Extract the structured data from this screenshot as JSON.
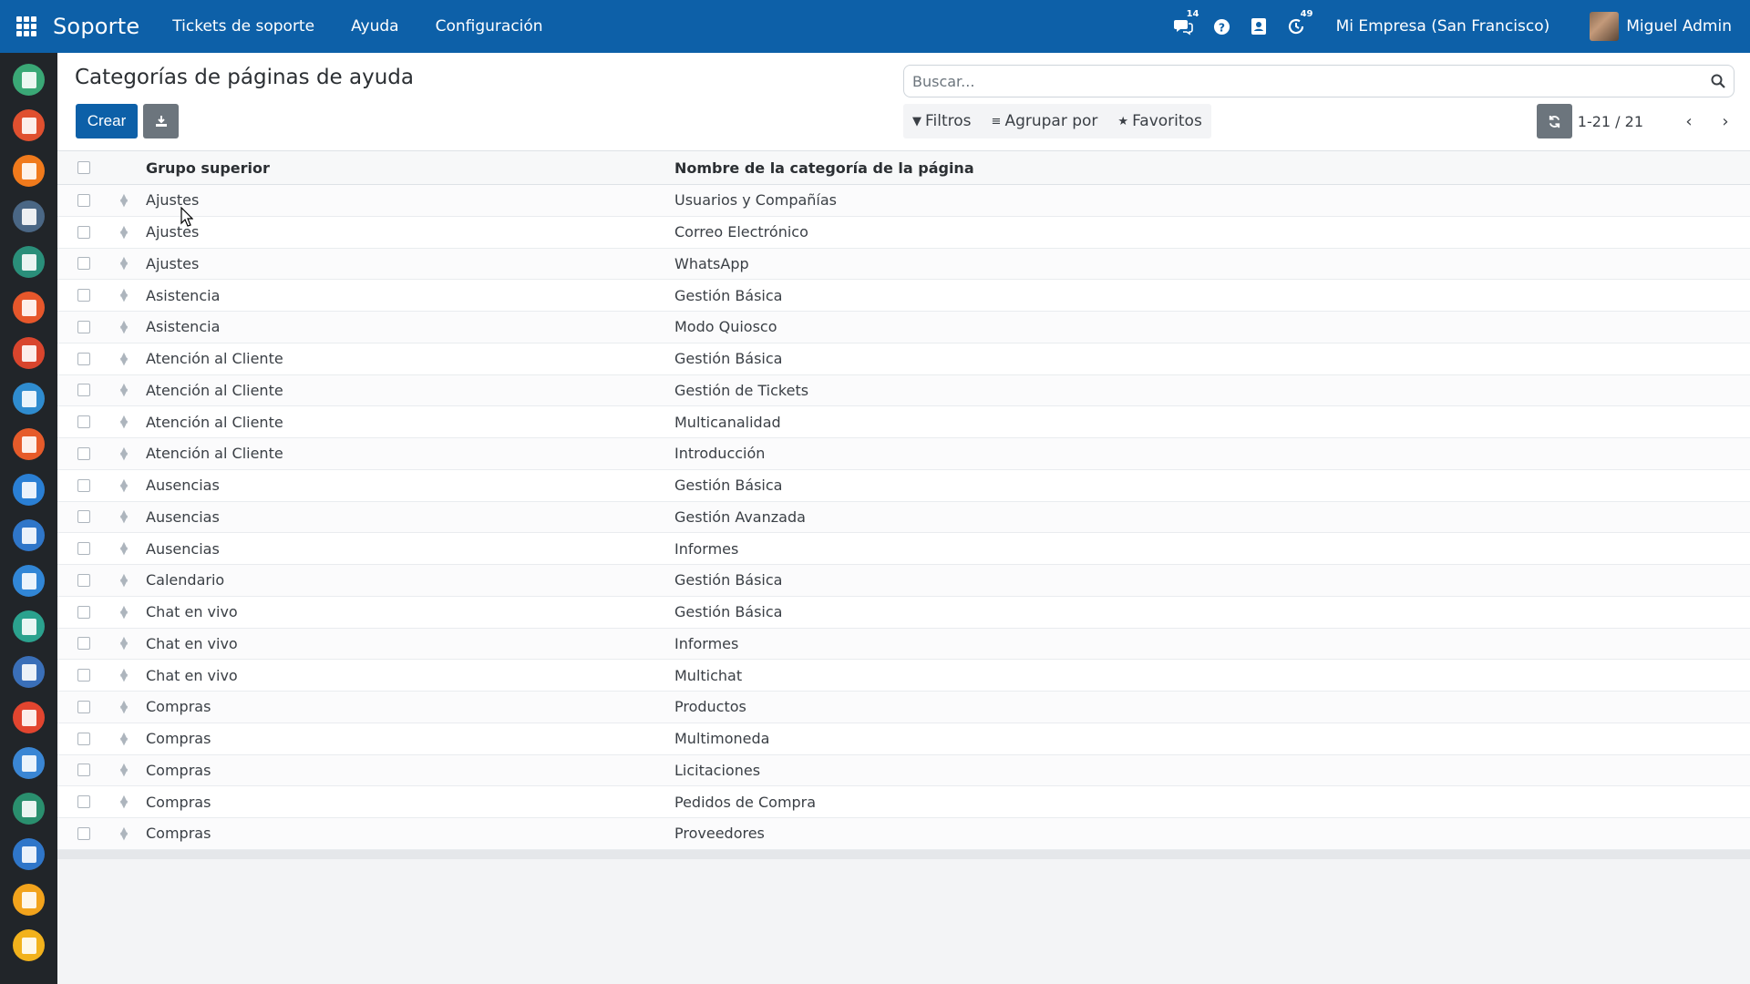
{
  "navbar": {
    "brand": "Soporte",
    "menu": [
      "Tickets de soporte",
      "Ayuda",
      "Configuración"
    ],
    "messages_count": "14",
    "activities_count": "49",
    "company": "Mi Empresa (San Francisco)",
    "user": "Miguel Admin"
  },
  "sidebar": {
    "apps": [
      {
        "icon": "app-icon-1",
        "color": "#3aa876"
      },
      {
        "icon": "calendar-icon",
        "color": "#e0502f"
      },
      {
        "icon": "notes-icon",
        "color": "#f07a1c"
      },
      {
        "icon": "team-icon",
        "color": "#4a6785"
      },
      {
        "icon": "employee-icon",
        "color": "#2a8f7a"
      },
      {
        "icon": "app-icon-6",
        "color": "#e6572b"
      },
      {
        "icon": "reports-icon",
        "color": "#d9452d"
      },
      {
        "icon": "support-icon",
        "color": "#2f8ccf"
      },
      {
        "icon": "app-icon-9",
        "color": "#e65b2a"
      },
      {
        "icon": "device-icon",
        "color": "#2a7fd4"
      },
      {
        "icon": "calculator-icon",
        "color": "#2f76c9"
      },
      {
        "icon": "planner-icon",
        "color": "#3186d6"
      },
      {
        "icon": "app-icon-13",
        "color": "#2ba28e"
      },
      {
        "icon": "store-icon",
        "color": "#3a6fb8"
      },
      {
        "icon": "schedule-icon",
        "color": "#e2452f"
      },
      {
        "icon": "window-icon",
        "color": "#3a86d4"
      },
      {
        "icon": "flag-icon",
        "color": "#2a8f6e"
      },
      {
        "icon": "document-icon",
        "color": "#2f76c9"
      },
      {
        "icon": "folder-icon",
        "color": "#f2a31c"
      },
      {
        "icon": "list-icon",
        "color": "#f2b21c"
      }
    ]
  },
  "page": {
    "title": "Categorías de páginas de ayuda",
    "create_label": "Crear",
    "search_placeholder": "Buscar...",
    "filters_label": "Filtros",
    "groupby_label": "Agrupar por",
    "favorites_label": "Favoritos",
    "pager": "1-21 / 21"
  },
  "table": {
    "columns": [
      "Grupo superior",
      "Nombre de la categoría de la página"
    ],
    "rows": [
      [
        "Ajustes",
        "Usuarios y Compañías"
      ],
      [
        "Ajustes",
        "Correo Electrónico"
      ],
      [
        "Ajustes",
        "WhatsApp"
      ],
      [
        "Asistencia",
        "Gestión Básica"
      ],
      [
        "Asistencia",
        "Modo Quiosco"
      ],
      [
        "Atención al Cliente",
        "Gestión Básica"
      ],
      [
        "Atención al Cliente",
        "Gestión de Tickets"
      ],
      [
        "Atención al Cliente",
        "Multicanalidad"
      ],
      [
        "Atención al Cliente",
        "Introducción"
      ],
      [
        "Ausencias",
        "Gestión Básica"
      ],
      [
        "Ausencias",
        "Gestión Avanzada"
      ],
      [
        "Ausencias",
        "Informes"
      ],
      [
        "Calendario",
        "Gestión Básica"
      ],
      [
        "Chat en vivo",
        "Gestión Básica"
      ],
      [
        "Chat en vivo",
        "Informes"
      ],
      [
        "Chat en vivo",
        "Multichat"
      ],
      [
        "Compras",
        "Productos"
      ],
      [
        "Compras",
        "Multimoneda"
      ],
      [
        "Compras",
        "Licitaciones"
      ],
      [
        "Compras",
        "Pedidos de Compra"
      ],
      [
        "Compras",
        "Proveedores"
      ]
    ]
  }
}
